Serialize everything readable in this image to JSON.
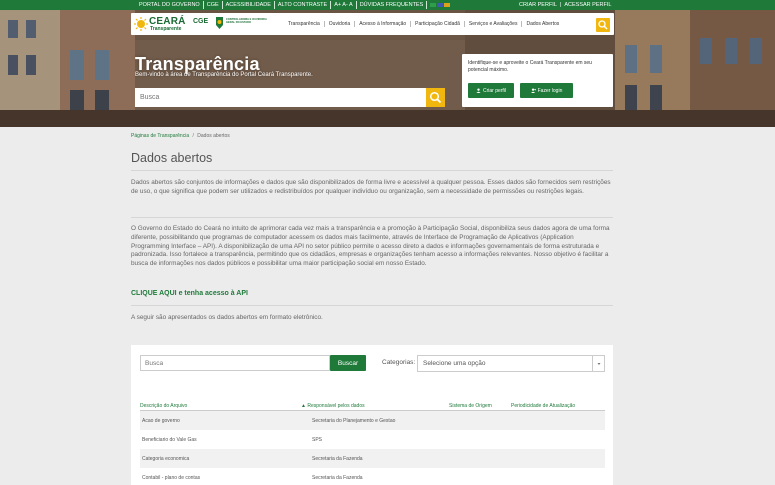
{
  "topbar": {
    "left_items": [
      "PORTAL DO GOVERNO",
      "CGE",
      "ACESSIBILIDADE",
      "ALTO CONTRASTE",
      "A+  A-  A",
      "DÚVIDAS FREQUENTES"
    ],
    "right_items": [
      "CRIAR PERFIL",
      "|",
      "ACESSAR PERFIL"
    ]
  },
  "logo": {
    "brand": "CEARÁ",
    "brand_sub": "Transparente",
    "cge": "CGE",
    "cge_text": "CONTROLADORIA E OUVIDORIA GERAL DO ESTADO"
  },
  "nav": {
    "items": [
      "Transparência",
      "Ouvidoria",
      "Acesso à Informação",
      "Participação Cidadã",
      "Serviços e Avaliações",
      "Dados Abertos"
    ]
  },
  "hero": {
    "title": "Transparência",
    "subtitle": "Bem-vindo à área de Transparência do Portal Ceará Transparente.",
    "search_placeholder": "Busca"
  },
  "login_card": {
    "message": "Identifique-se e aproveite o Ceará Transparente em seu potencial máximo.",
    "create_label": "Criar perfil",
    "login_label": "Fazer login"
  },
  "breadcrumb": {
    "parent": "Páginas de Transparência",
    "separator": "/",
    "current": "Dados abertos"
  },
  "page": {
    "title": "Dados abertos",
    "para1": "Dados abertos são conjuntos de informações e dados que são disponibilizados de forma livre e acessível a qualquer pessoa. Esses dados são fornecidos sem restrições de uso, o que significa que podem ser utilizados e redistribuídos por qualquer indivíduo ou organização, sem a necessidade de permissões ou restrições legais.",
    "para2": "O Governo do Estado do Ceará no intuito de aprimorar cada vez mais a transparência e a promoção à Participação Social, disponibiliza seus dados agora de uma forma diferente, possibilitando que programas de computador acessem os dados mais facilmente, através de Interface de Programação de Aplicativos (Application Programming Interface – API). A disponibilização de uma API no setor público permite o acesso direto a dados e informações governamentais de forma estruturada e padronizada. Isso fortalece a transparência, permitindo que os cidadãos, empresas e organizações tenham acesso a informações relevantes. Nosso objetivo é facilitar a busca de informações nos dados públicos e possibilitar uma maior participação social em nosso Estado.",
    "api_link": "CLIQUE AQUI e tenha acesso à API",
    "para3": "A seguir são apresentados os dados abertos em formato eletrônico."
  },
  "panel": {
    "search_placeholder": "Busca",
    "search_button": "Buscar",
    "category_label": "Categorias:",
    "category_value": "Selecione uma opção",
    "columns": [
      "Descrição do Arquivo",
      "▲ Responsável pelos dados",
      "Sistema de Origem",
      "Periodicidade de Atualização"
    ],
    "rows": [
      {
        "desc": "Acao de governo",
        "resp": "Secretaria do Planejamento e Gestao"
      },
      {
        "desc": "Beneficiario do Vale Gas",
        "resp": "SPS"
      },
      {
        "desc": "Categoria economica",
        "resp": "Secretaria da Fazenda"
      },
      {
        "desc": "Contabil - plano de contas",
        "resp": "Secretaria da Fazenda"
      }
    ]
  },
  "colors": {
    "green": "#1f7a3a",
    "yellow": "#f2b70f",
    "background": "#ececec"
  }
}
